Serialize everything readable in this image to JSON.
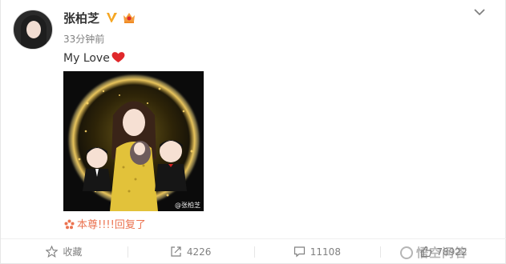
{
  "author": {
    "name": "张柏芝",
    "time": "33分钟前"
  },
  "post": {
    "text": "My Love",
    "image_watermark": "@张柏芝"
  },
  "reply_notice": "本尊!!!!回复了",
  "actions": {
    "favorite": "收藏",
    "repost": "4226",
    "comment": "11108",
    "like": "78922"
  },
  "site_watermark": "悟空问答",
  "colors": {
    "accent": "#eb7350",
    "verified": "#f5a623",
    "heart": "#e0282b"
  }
}
